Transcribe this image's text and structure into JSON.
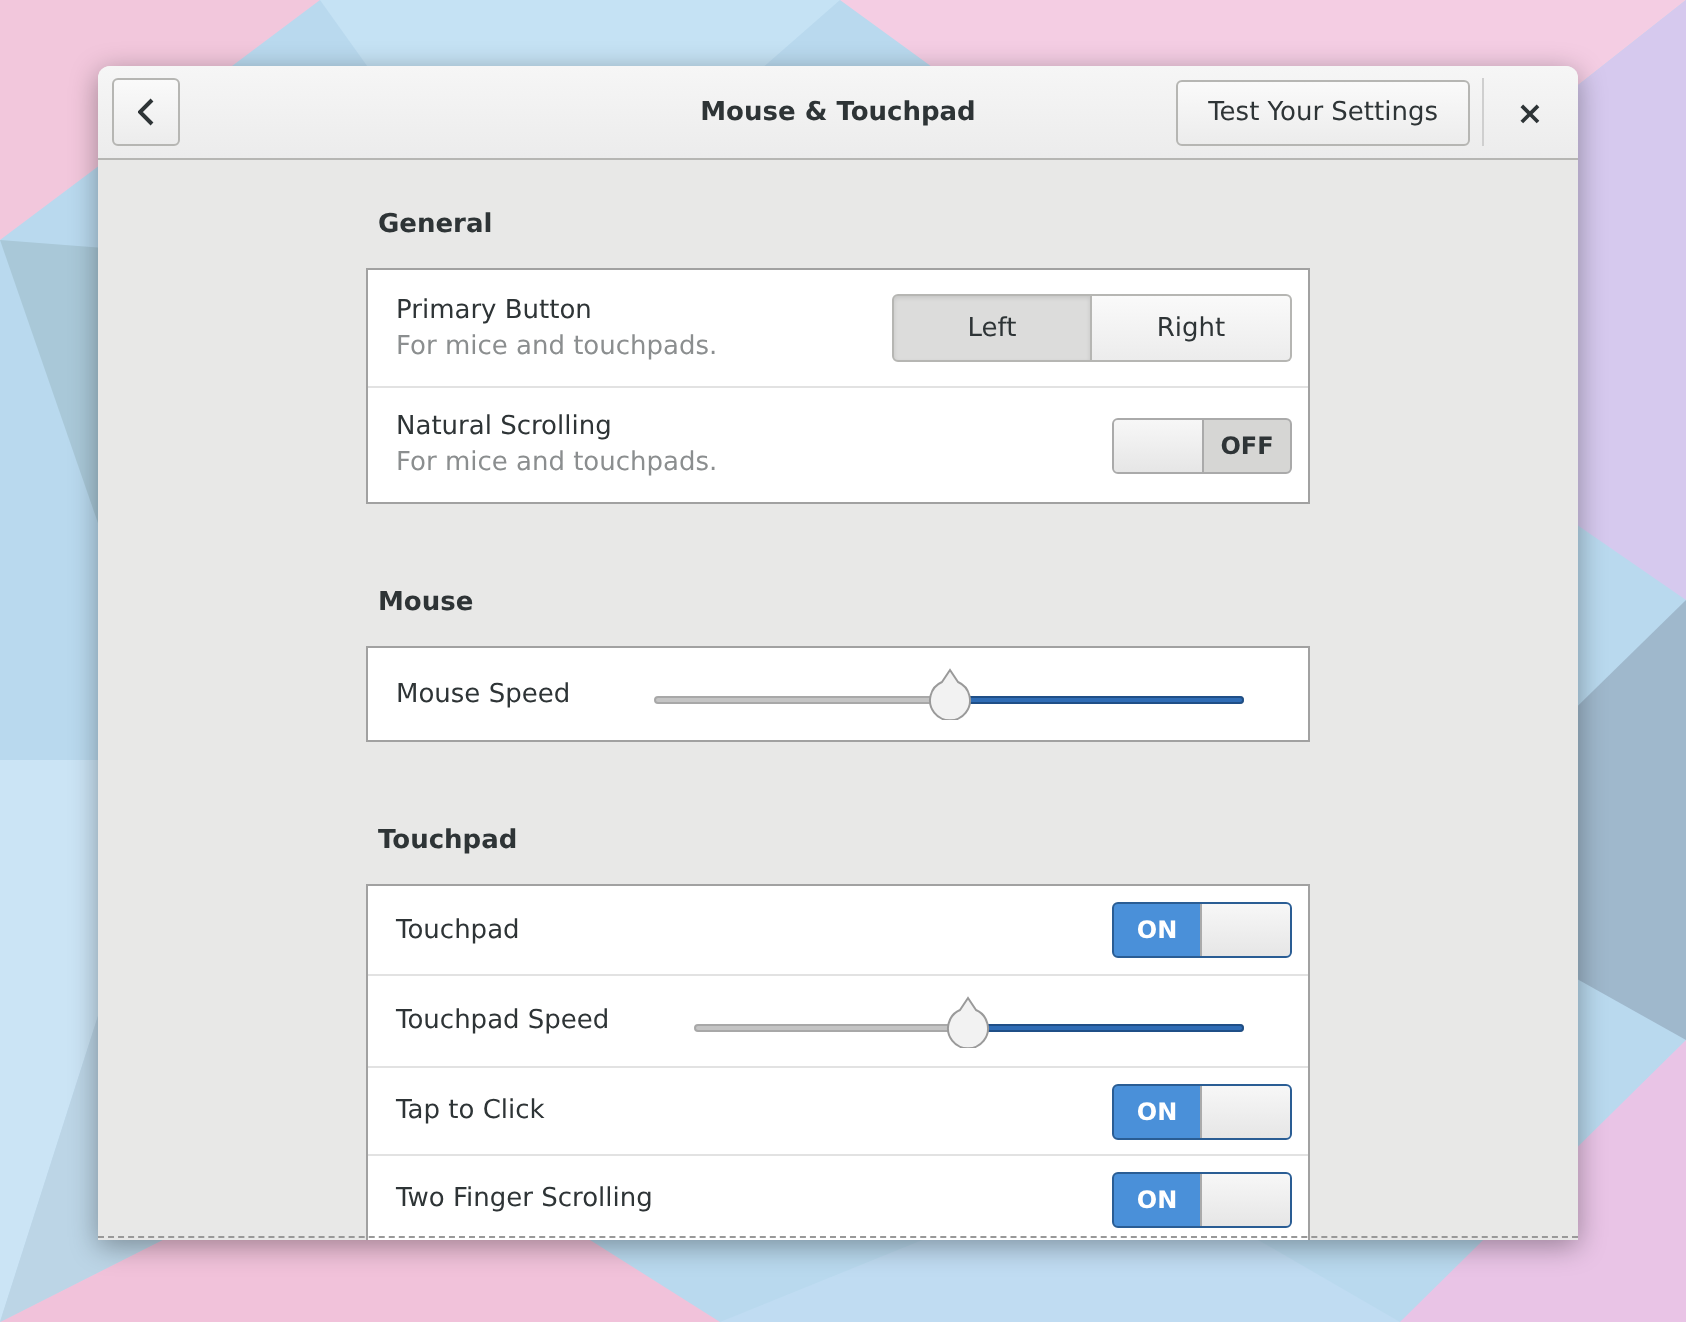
{
  "window": {
    "title": "Mouse & Touchpad",
    "test_button": "Test Your Settings",
    "close_button": "×"
  },
  "sections": [
    {
      "title": "General",
      "rows": [
        {
          "kind": "choice",
          "label": "Primary Button",
          "description": "For mice and touchpads.",
          "options": [
            {
              "label": "Left",
              "selected": true
            },
            {
              "label": "Right",
              "selected": false
            }
          ]
        },
        {
          "kind": "switch",
          "label": "Natural Scrolling",
          "description": "For mice and touchpads.",
          "on": false,
          "switch_text": "OFF"
        }
      ]
    },
    {
      "title": "Mouse",
      "rows": [
        {
          "kind": "slider",
          "label": "Mouse Speed",
          "level": 0.5
        }
      ]
    },
    {
      "title": "Touchpad",
      "rows": [
        {
          "kind": "switch",
          "label": "Touchpad",
          "on": true,
          "switch_text": "ON"
        },
        {
          "kind": "slider",
          "label": "Touchpad Speed",
          "level": 0.5
        },
        {
          "kind": "switch",
          "label": "Tap to Click",
          "on": true,
          "switch_text": "ON"
        },
        {
          "kind": "switch",
          "label": "Two Finger Scrolling",
          "on": true,
          "switch_text": "ON"
        }
      ]
    }
  ]
}
